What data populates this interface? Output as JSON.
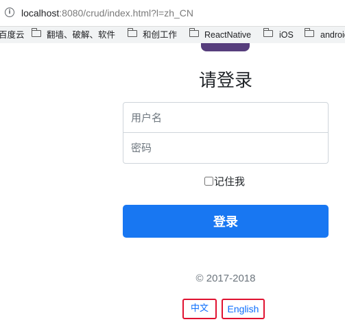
{
  "browser": {
    "url_host": "localhost",
    "url_rest": ":8080/crud/index.html?l=zh_CN",
    "bookmarks": [
      {
        "label": "百度云",
        "folder": false
      },
      {
        "label": "翻墙、破解、软件",
        "folder": true
      },
      {
        "label": "和创工作",
        "folder": true
      },
      {
        "label": "ReactNative",
        "folder": true
      },
      {
        "label": "iOS",
        "folder": true
      },
      {
        "label": "android",
        "folder": true
      }
    ]
  },
  "colors": {
    "primary": "#1877f2",
    "brand": "#563d7c",
    "link": "#0d6efd",
    "highlight_border": "#e0102f"
  },
  "login": {
    "title": "请登录",
    "username_placeholder": "用户名",
    "password_placeholder": "密码",
    "remember_label": "记住我",
    "remember_checked": false,
    "submit_label": "登录"
  },
  "footer": {
    "copyright": "© 2017-2018",
    "lang_zh": "中文",
    "lang_en": "English"
  }
}
